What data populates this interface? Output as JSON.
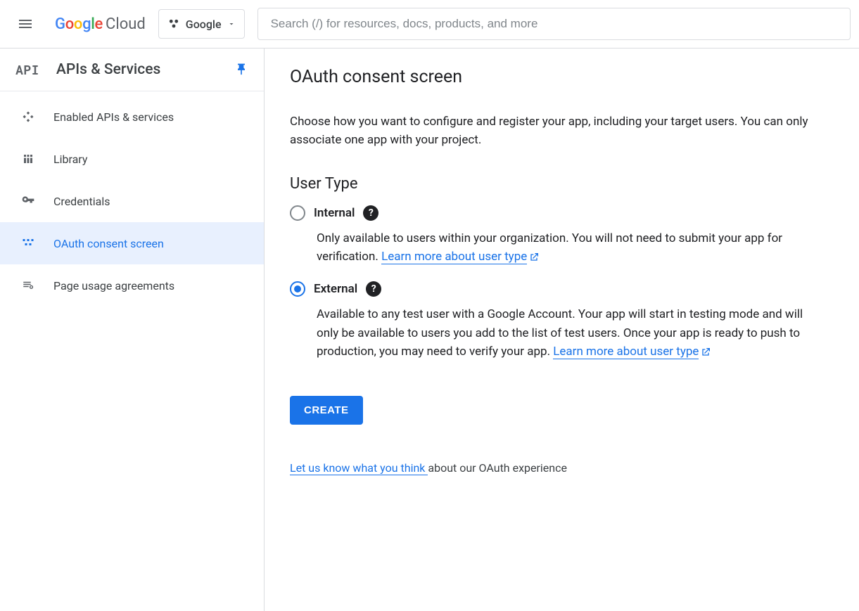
{
  "header": {
    "logo_google": "Google",
    "logo_cloud": "Cloud",
    "project_name": "Google",
    "search_placeholder": "Search (/) for resources, docs, products, and more"
  },
  "sidebar": {
    "badge": "API",
    "title": "APIs & Services",
    "items": [
      {
        "label": "Enabled APIs & services",
        "icon": "diamond-plus",
        "active": false
      },
      {
        "label": "Library",
        "icon": "library",
        "active": false
      },
      {
        "label": "Credentials",
        "icon": "key",
        "active": false
      },
      {
        "label": "OAuth consent screen",
        "icon": "consent",
        "active": true
      },
      {
        "label": "Page usage agreements",
        "icon": "agreements",
        "active": false
      }
    ]
  },
  "main": {
    "title": "OAuth consent screen",
    "intro": "Choose how you want to configure and register your app, including your target users. You can only associate one app with your project.",
    "user_type_heading": "User Type",
    "options": {
      "internal": {
        "label": "Internal",
        "selected": false,
        "desc": "Only available to users within your organization. You will not need to submit your app for verification. ",
        "link": "Learn more about user type"
      },
      "external": {
        "label": "External",
        "selected": true,
        "desc": "Available to any test user with a Google Account. Your app will start in testing mode and will only be available to users you add to the list of test users. Once your app is ready to push to production, you may need to verify your app. ",
        "link": "Learn more about user type"
      }
    },
    "create_button": "CREATE",
    "feedback_link": "Let us know what you think ",
    "feedback_text": "about our OAuth experience"
  }
}
